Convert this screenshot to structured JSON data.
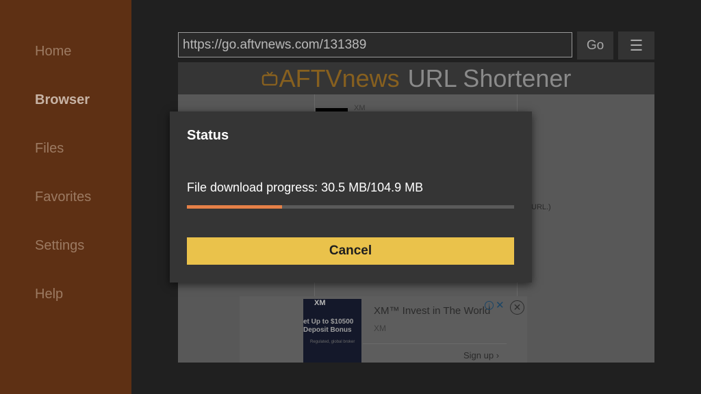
{
  "sidebar": {
    "items": [
      {
        "label": "Home"
      },
      {
        "label": "Browser"
      },
      {
        "label": "Files"
      },
      {
        "label": "Favorites"
      },
      {
        "label": "Settings"
      },
      {
        "label": "Help"
      }
    ]
  },
  "toolbar": {
    "url": "https://go.aftvnews.com/131389",
    "go_label": "Go",
    "menu_icon": "menu-icon"
  },
  "webpage": {
    "header_brand": "AFTVnews",
    "header_rest": "URL Shortener",
    "xm_label": "XM",
    "url_note": "URL.)",
    "ad": {
      "logo": "XM",
      "promo": "et Up to $10500\nDeposit Bonus",
      "small": "Regulated, global broker",
      "title": "XM™ Invest in The World",
      "subtitle": "XM",
      "signup": "Sign up ›"
    }
  },
  "dialog": {
    "title": "Status",
    "progress_text": "File download progress: 30.5 MB/104.9 MB",
    "progress_fraction": 0.29,
    "cancel_label": "Cancel"
  },
  "colors": {
    "sidebar_bg": "#5e3014",
    "accent_orange": "#e58047",
    "cancel_yellow": "#eac24b"
  }
}
